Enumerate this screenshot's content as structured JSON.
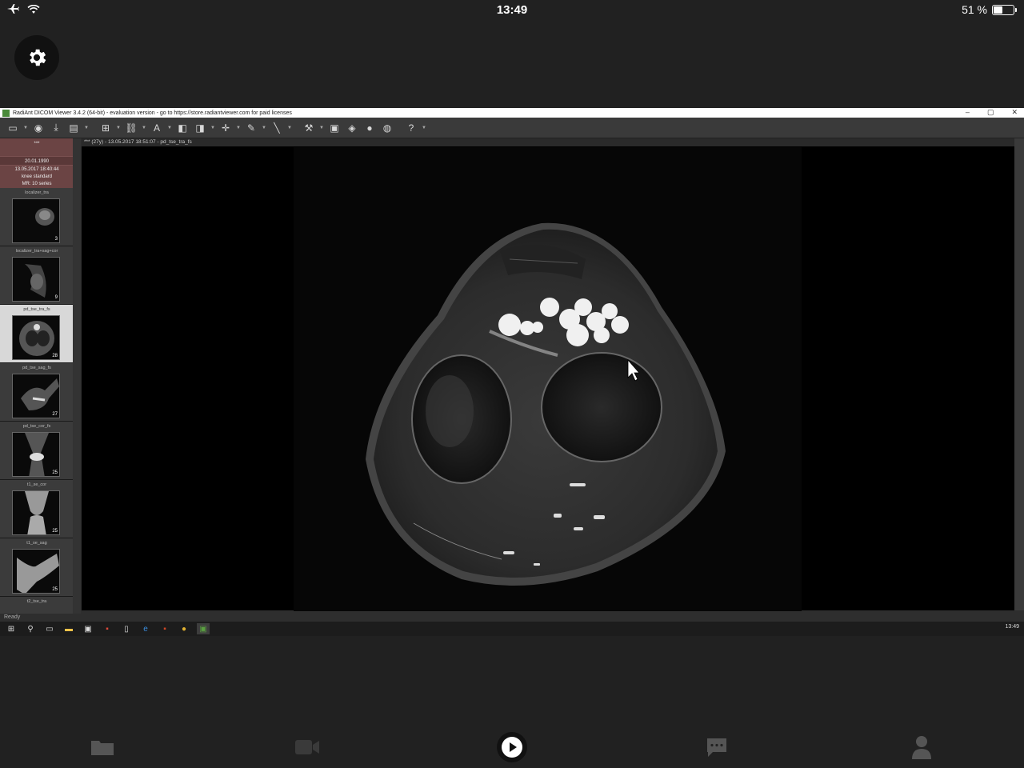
{
  "status_bar": {
    "time": "13:49",
    "battery_text": "51 %",
    "battery_level": 0.51,
    "left_icons": [
      "airplane-icon",
      "wifi-icon"
    ]
  },
  "settings": {
    "icon": "gear-icon"
  },
  "window": {
    "title": "RadiAnt DICOM Viewer 3.4.2 (64-bit) - evaluation version - go to https://store.radiantviewer.com for paid licenses",
    "controls": [
      "–",
      "▢",
      "✕"
    ]
  },
  "toolbar": {
    "icons": [
      "open-folder-icon",
      "cd-icon",
      "download-icon",
      "save-icon",
      "layout-icon",
      "link-icon",
      "text-icon",
      "compare-icon",
      "contrast-icon",
      "crosshair-icon",
      "brush-icon",
      "measure-icon",
      "tools-icon",
      "export-icon",
      "mpr-icon",
      "3d-icon",
      "volume-icon",
      "help-icon"
    ]
  },
  "patient": {
    "name": "***",
    "dob": "20.01.1990",
    "study_datetime": "13.05.2017 18:40:44",
    "study_desc": "knee standard",
    "modality_series": "MR: 10 series"
  },
  "series": [
    {
      "label": "localizer_tra",
      "count": "3"
    },
    {
      "label": "localizer_tra+sag+cor",
      "count": "9"
    },
    {
      "label": "pd_tse_tra_fs",
      "count": "28"
    },
    {
      "label": "pd_tse_sag_fs",
      "count": "27"
    },
    {
      "label": "pd_tse_cor_fs",
      "count": "25"
    },
    {
      "label": "t1_se_cor",
      "count": "25"
    },
    {
      "label": "t1_se_sag",
      "count": "25"
    },
    {
      "label": "t2_tse_tra",
      "count": ""
    }
  ],
  "viewer": {
    "header": "*** (27y) - 13.05.2017 18:51:07 - pd_tse_tra_fs"
  },
  "app_status": "Ready",
  "taskbar": {
    "time": "13:49",
    "icons": [
      "windows-start-icon",
      "search-icon",
      "task-view-icon",
      "file-explorer-icon",
      "store-icon",
      "pdf-icon",
      "document-icon",
      "edge-icon",
      "powerpoint-icon",
      "chrome-icon",
      "radiant-icon"
    ]
  },
  "tabs": [
    {
      "icon": "folder-icon"
    },
    {
      "icon": "video-camera-icon"
    },
    {
      "icon": "play-icon"
    },
    {
      "icon": "chat-icon"
    },
    {
      "icon": "person-icon"
    }
  ]
}
